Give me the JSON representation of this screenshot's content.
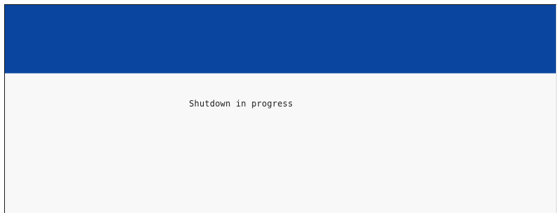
{
  "window": {
    "status_message": "Shutdown in progress",
    "header_color": "#0a469f",
    "background_color": "#f8f8f8"
  }
}
